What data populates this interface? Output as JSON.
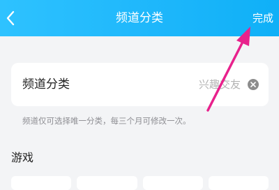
{
  "header": {
    "title": "频道分类",
    "done_label": "完成",
    "back_icon": "chevron-left-icon",
    "gradient": [
      "#2ec2ff",
      "#0fb0f7"
    ]
  },
  "category_field": {
    "label": "频道分类",
    "value": "兴趣交友",
    "clear_icon": "clear-icon"
  },
  "hint_text": "频道仅可选择唯一分类，每三个月可修改一次。",
  "section": {
    "title": "游戏"
  },
  "annotation": {
    "color": "#e8218c",
    "icon": "arrow-annotation"
  }
}
